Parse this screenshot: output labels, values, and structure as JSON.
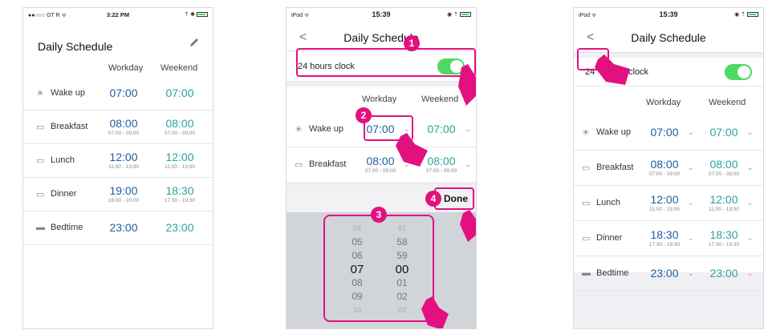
{
  "colors": {
    "workday": "#1f5ea0",
    "weekend": "#2aa39a",
    "accent": "#e3117f",
    "toggle": "#4cd964"
  },
  "screen1": {
    "status": {
      "left": "●●○○○ GT R ᯤ",
      "time": "3:22 PM",
      "right": "⇡ ✱"
    },
    "title": "Daily Schedule",
    "edit_icon": "pencil-icon",
    "col_workday": "Workday",
    "col_weekend": "Weekend",
    "rows": [
      {
        "icon": "☀",
        "label": "Wake up",
        "workday": "07:00",
        "workday_sub": "",
        "weekend": "07:00",
        "weekend_sub": ""
      },
      {
        "icon": "▭",
        "label": "Breakfast",
        "workday": "08:00",
        "workday_sub": "07:00 - 09:00",
        "weekend": "08:00",
        "weekend_sub": "07:00 - 09:00"
      },
      {
        "icon": "▭",
        "label": "Lunch",
        "workday": "12:00",
        "workday_sub": "11:00 - 13:00",
        "weekend": "12:00",
        "weekend_sub": "11:00 - 13:00"
      },
      {
        "icon": "▭",
        "label": "Dinner",
        "workday": "19:00",
        "workday_sub": "18:00 - 20:00",
        "weekend": "18:30",
        "weekend_sub": "17:30 - 19:30"
      },
      {
        "icon": "▬",
        "label": "Bedtime",
        "workday": "23:00",
        "workday_sub": "",
        "weekend": "23:00",
        "weekend_sub": ""
      }
    ]
  },
  "screen2": {
    "status": {
      "left": "iPod ᯤ",
      "time": "15:39",
      "right": "◉ ⇡"
    },
    "back": "<",
    "title": "Daily Schedule",
    "toggle_label": "24 hours clock",
    "col_workday": "Workday",
    "col_weekend": "Weekend",
    "rows": [
      {
        "icon": "☀",
        "label": "Wake up",
        "workday": "07:00",
        "workday_sub": "",
        "weekend": "07:00",
        "weekend_sub": ""
      },
      {
        "icon": "▭",
        "label": "Breakfast",
        "workday": "08:00",
        "workday_sub": "07:00 - 09:00",
        "weekend": "08:00",
        "weekend_sub": "07:00 - 09:00"
      }
    ],
    "done": "Done",
    "picker_hours": [
      "04",
      "05",
      "06",
      "07",
      "08",
      "09",
      "10"
    ],
    "picker_minutes": [
      "57",
      "58",
      "59",
      "00",
      "01",
      "02",
      "03"
    ],
    "steps": [
      "1",
      "2",
      "3",
      "4"
    ]
  },
  "screen3": {
    "status": {
      "left": "iPod ᯤ",
      "time": "15:39",
      "right": "◉ ⇡"
    },
    "back": "<",
    "title": "Daily Schedule",
    "toggle_label_a": "24",
    "toggle_label_b": "clock",
    "col_workday": "Workday",
    "col_weekend": "Weekend",
    "rows": [
      {
        "icon": "☀",
        "label": "Wake up",
        "workday": "07:00",
        "workday_sub": "",
        "weekend": "07:00",
        "weekend_sub": ""
      },
      {
        "icon": "▭",
        "label": "Breakfast",
        "workday": "08:00",
        "workday_sub": "07:00 - 09:00",
        "weekend": "08:00",
        "weekend_sub": "07:00 - 09:00"
      },
      {
        "icon": "▭",
        "label": "Lunch",
        "workday": "12:00",
        "workday_sub": "11:00 - 13:00",
        "weekend": "12:00",
        "weekend_sub": "11:00 - 13:00"
      },
      {
        "icon": "▭",
        "label": "Dinner",
        "workday": "18:30",
        "workday_sub": "17:30 - 19:30",
        "weekend": "18:30",
        "weekend_sub": "17:30 - 19:30"
      },
      {
        "icon": "▬",
        "label": "Bedtime",
        "workday": "23:00",
        "workday_sub": "",
        "weekend": "23:00",
        "weekend_sub": ""
      }
    ]
  }
}
